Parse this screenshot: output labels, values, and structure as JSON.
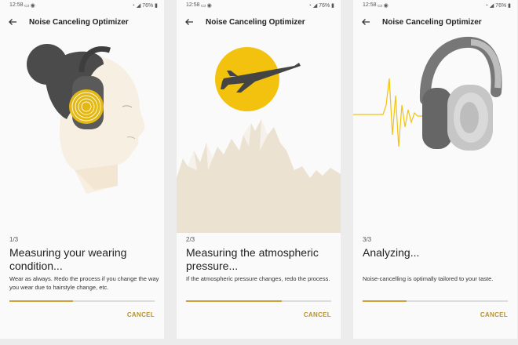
{
  "screens": [
    {
      "status": {
        "time": "12:58",
        "battery": "76%"
      },
      "title": "Noise Canceling Optimizer",
      "step": "1/3",
      "headline": "Measuring your wearing condition...",
      "description": "Wear as always. Redo the process if you change the way you wear due to hairstyle change, etc.",
      "progress": 0.44,
      "cancel_label": "CANCEL"
    },
    {
      "status": {
        "time": "12:58",
        "battery": "76%"
      },
      "title": "Noise Canceling Optimizer",
      "step": "2/3",
      "headline": "Measuring the atmospheric pressure...",
      "description": "If the atmospheric pressure changes, redo the process.",
      "progress": 0.66,
      "cancel_label": "CANCEL"
    },
    {
      "status": {
        "time": "12:58",
        "battery": "76%"
      },
      "title": "Noise Canceling Optimizer",
      "step": "3/3",
      "headline": "Analyzing...",
      "description": "Noise-cancelling is optimally tailored to your taste.",
      "progress": 0.3,
      "cancel_label": "CANCEL"
    }
  ],
  "colors": {
    "accent": "#cda23a",
    "cancel": "#b8922a",
    "sun": "#f2c20e",
    "dark": "#555555"
  }
}
